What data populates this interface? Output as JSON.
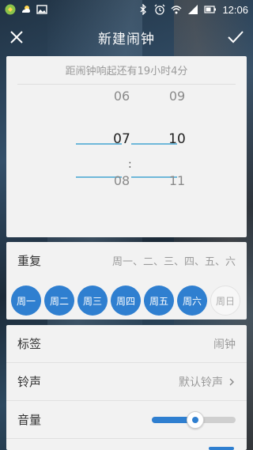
{
  "status_bar": {
    "time": "12:06",
    "left_icons": [
      "app-notification-icon",
      "weather-icon",
      "image-icon"
    ],
    "right_icons": [
      "bluetooth-icon",
      "alarm-icon",
      "wifi-icon",
      "signal-icon",
      "battery-icon"
    ]
  },
  "app_bar": {
    "title": "新建闹钟",
    "close_icon": "close-icon",
    "confirm_icon": "check-icon"
  },
  "picker": {
    "hint": "距闹钟响起还有19小时4分",
    "hours": [
      "06",
      "07",
      "08"
    ],
    "minutes": [
      "09",
      "10",
      "11"
    ],
    "separator": ":",
    "line_color": "#6fb8d9"
  },
  "repeat": {
    "label": "重复",
    "value": "周一、二、三、四、五、六",
    "days": [
      {
        "label": "周一",
        "active": true
      },
      {
        "label": "周二",
        "active": true
      },
      {
        "label": "周三",
        "active": true
      },
      {
        "label": "周四",
        "active": true
      },
      {
        "label": "周五",
        "active": true
      },
      {
        "label": "周六",
        "active": true
      },
      {
        "label": "周日",
        "active": false
      }
    ],
    "active_color": "#2f7fd0"
  },
  "settings": {
    "tag": {
      "label": "标签",
      "value": "闹钟"
    },
    "ringtone": {
      "label": "铃声",
      "value": "默认铃声"
    },
    "volume": {
      "label": "音量",
      "level": 0.52
    }
  }
}
